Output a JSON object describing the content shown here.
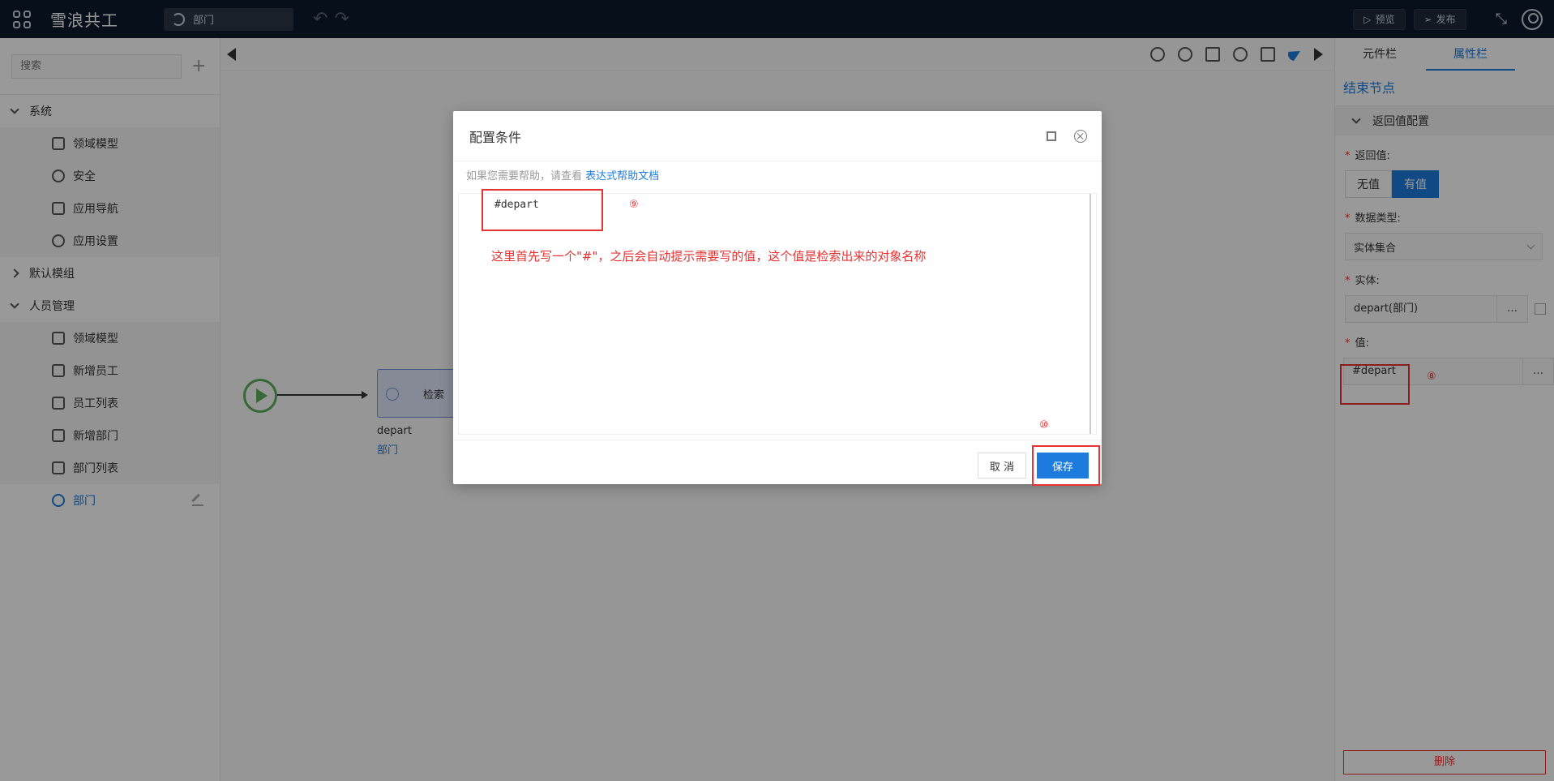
{
  "app": {
    "title": "雪浪共工"
  },
  "topbar": {
    "tab_label": "部门",
    "preview_label": "预览",
    "publish_label": "发布"
  },
  "sidebar": {
    "search_placeholder": "搜索",
    "groups": [
      {
        "label": "系统",
        "items": [
          "领域模型",
          "安全",
          "应用导航",
          "应用设置"
        ]
      },
      {
        "label": "默认模组",
        "items": []
      },
      {
        "label": "人员管理",
        "items": [
          "领域模型",
          "新增员工",
          "员工列表",
          "新增部门",
          "部门列表",
          "部门"
        ]
      }
    ]
  },
  "canvas": {
    "node_label": "检索",
    "node_name": "depart",
    "node_entity": "部门"
  },
  "rpanel": {
    "tabs": [
      "元件栏",
      "属性栏"
    ],
    "title": "结束节点",
    "section": "返回值配置",
    "return_label": "返回值:",
    "return_opts": [
      "无值",
      "有值"
    ],
    "type_label": "数据类型:",
    "type_value": "实体集合",
    "entity_label": "实体:",
    "entity_value": "depart(部门)",
    "value_label": "值:",
    "value_value": "#depart",
    "dots": "...",
    "anno_8": "⑧",
    "delete_label": "删除"
  },
  "modal": {
    "title": "配置条件",
    "hint_text": "如果您需要帮助，请查看",
    "hint_link": "表达式帮助文档",
    "code": "#depart",
    "anno_9": "⑨",
    "anno_10": "⑩",
    "anno_text": "这里首先写一个\"#\"，之后会自动提示需要写的值，这个值是检索出来的对象名称",
    "cancel_label": "取 消",
    "save_label": "保存"
  },
  "colors": {
    "accent": "#1c7bdc",
    "annotation": "#e63333",
    "topbar": "#0d1a2e"
  }
}
